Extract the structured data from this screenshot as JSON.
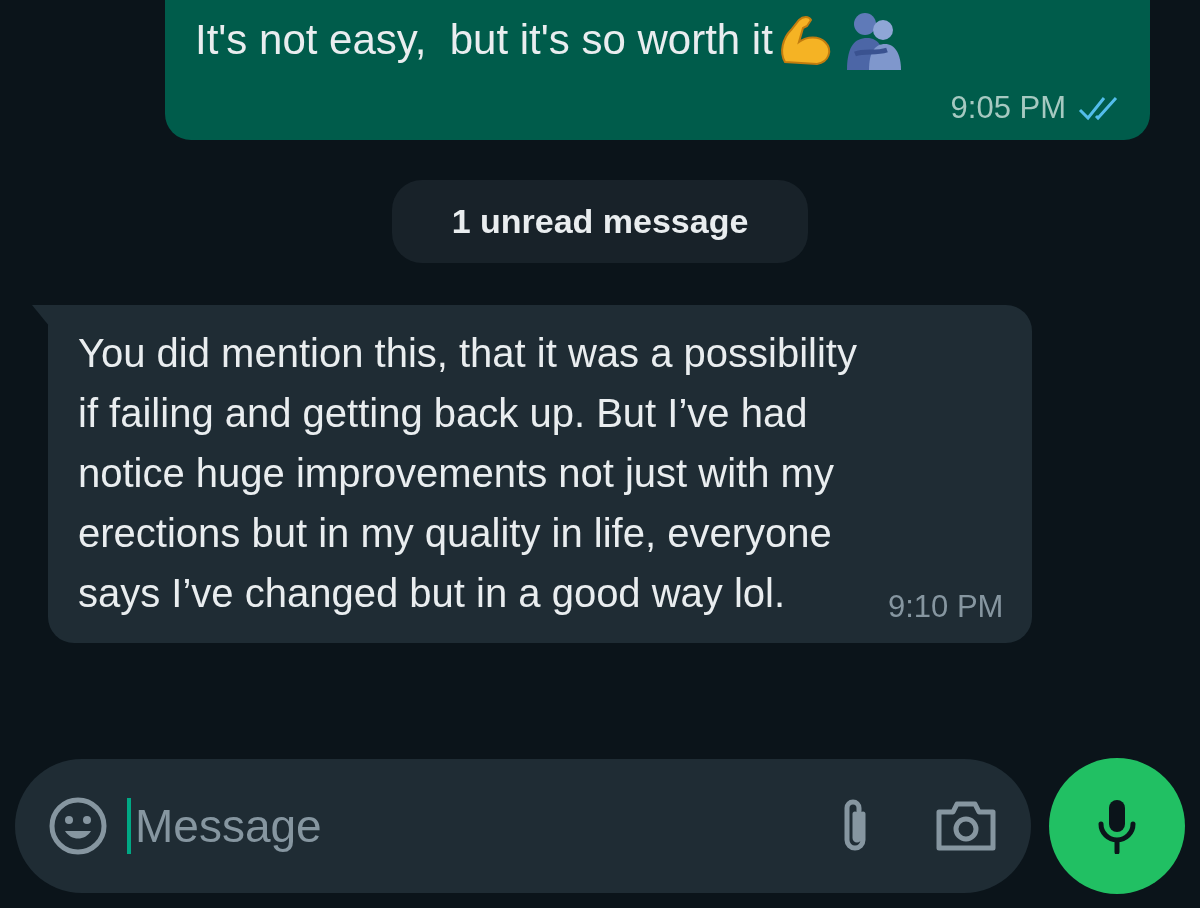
{
  "outgoing_message": {
    "text": "It's not easy,  but it's so worth it",
    "time": "9:05 PM",
    "read": true
  },
  "unread_banner": {
    "text": "1 unread message"
  },
  "incoming_message": {
    "text": "You did mention this, that it was a possibility if failing and getting back up. But I’ve had notice huge improvements not just with my erections but in my quality in life, everyone says I’ve changed but in a good way lol.",
    "time": "9:10 PM"
  },
  "composer": {
    "placeholder": "Message"
  }
}
